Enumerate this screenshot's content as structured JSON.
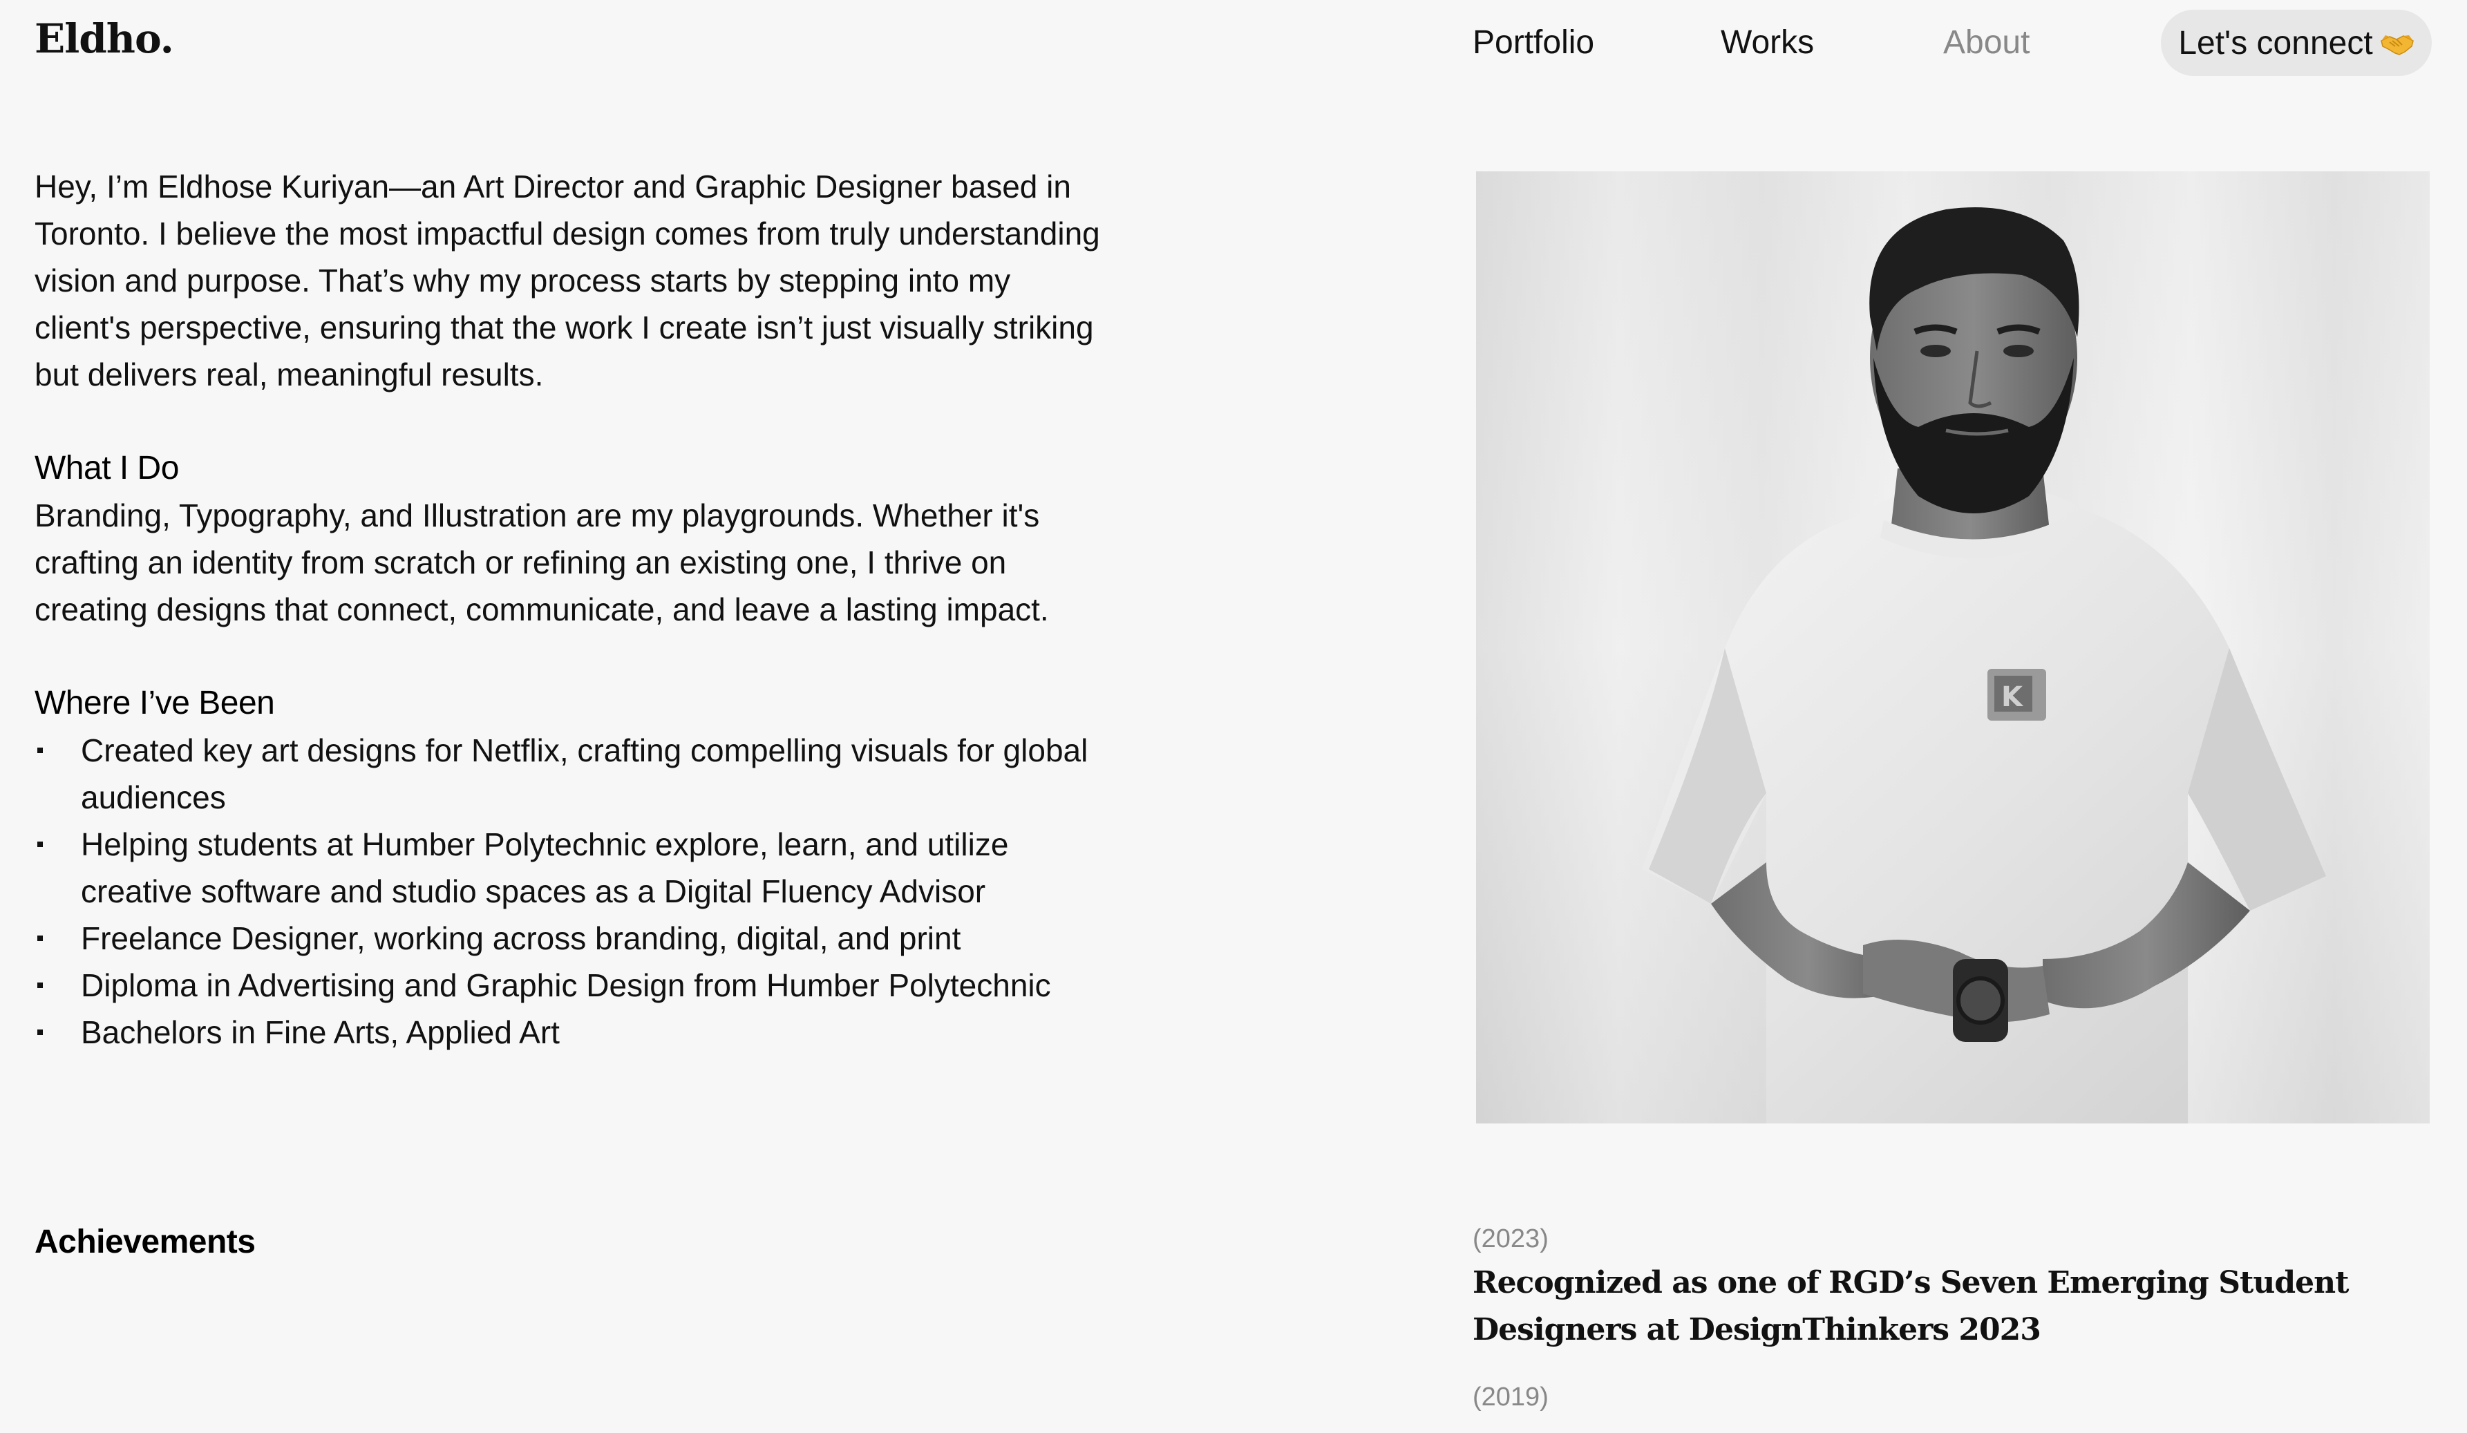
{
  "header": {
    "logo": "Eldho.",
    "nav": {
      "portfolio": "Portfolio",
      "works": "Works",
      "about": "About",
      "connect": "Let's connect",
      "connect_icon": "handshake-icon"
    }
  },
  "intro": {
    "paragraph": "Hey, I’m Eldhose Kuriyan—an Art Director and Graphic Designer based in Toronto. I believe the most impactful design comes from truly understanding vision and purpose. That’s why my process starts by stepping into my client's perspective, ensuring that the work I create isn’t just visually striking but delivers real, meaningful results.",
    "what_title": "What I Do",
    "what_body": "Branding, Typography, and Illustration are my playgrounds. Whether it's crafting an identity from scratch or refining an existing one, I thrive on creating designs that connect, communicate, and leave a lasting impact.",
    "where_title": "Where I’ve Been",
    "where_items": [
      "Created key art designs for Netflix, crafting compelling visuals for global audiences",
      "Helping students at Humber Polytechnic  explore, learn, and utilize creative software and studio spaces as a Digital Fluency Advisor",
      "Freelance Designer, working across branding, digital, and print",
      "Diploma in Advertising and Graphic Design from Humber Polytechnic",
      "Bachelors in Fine Arts, Applied Art"
    ]
  },
  "achievements": {
    "title": "Achievements",
    "items": [
      {
        "year": "(2023)",
        "text": "Recognized as one of RGD’s Seven Emerging Student Designers at DesignThinkers 2023"
      },
      {
        "year": "(2019)",
        "text": ""
      }
    ]
  },
  "colors": {
    "background": "#f7f7f7",
    "text": "#111111",
    "muted": "#888888",
    "button_bg": "#e7e7e7"
  }
}
